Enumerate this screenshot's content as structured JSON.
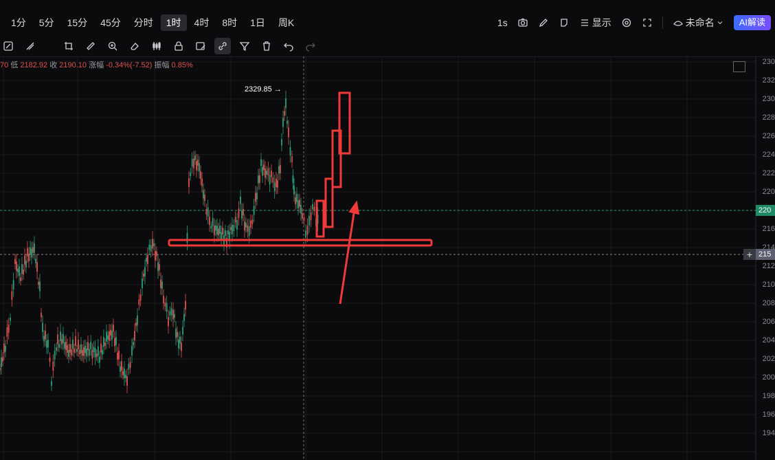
{
  "timeframes": [
    "1分",
    "5分",
    "15分",
    "45分",
    "分时",
    "1时",
    "4时",
    "8时",
    "1日",
    "周K"
  ],
  "active_timeframe": "1时",
  "right_tools": {
    "interval": "1s",
    "display_label": "显示",
    "layout_name": "未命名",
    "ai_label": "AI解读"
  },
  "info": {
    "prefix": "70",
    "low_label": "低",
    "low_value": "2182.92",
    "close_label": "收",
    "close_value": "2190.10",
    "change_label": "涨幅",
    "change_value": "-0.34%(-7.52)",
    "amp_label": "振幅",
    "amp_value": "0.85%"
  },
  "high_marker": "2329.85 →",
  "y_axis_ticks": [
    "230",
    "232",
    "230",
    "228",
    "226",
    "224",
    "222",
    "220",
    "218",
    "216",
    "214",
    "212",
    "210",
    "208",
    "206",
    "204",
    "202",
    "200",
    "198",
    "196",
    "194"
  ],
  "price_tag_current": "220",
  "price_tag_cross": "215",
  "colors": {
    "up": "#26a17b",
    "down": "#e0524f",
    "annotation": "#f03a3a",
    "ai_button": "#4a5cff"
  }
}
